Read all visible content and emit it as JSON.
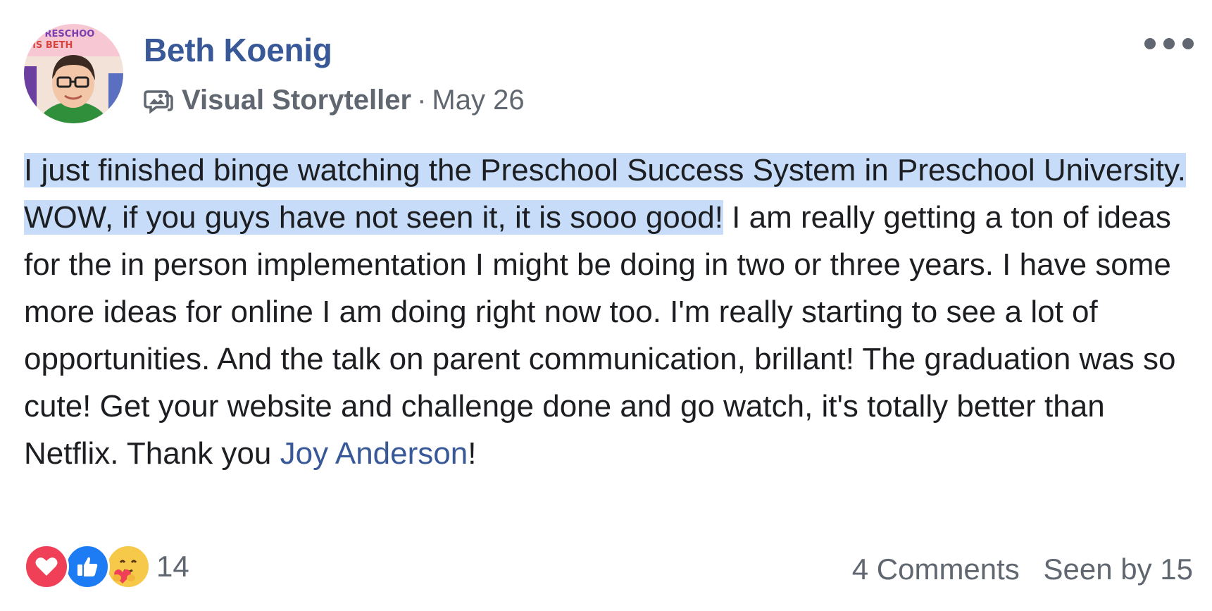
{
  "author": {
    "name": "Beth Koenig",
    "avatar_sign": "PRESCHOOL MS BETH"
  },
  "meta": {
    "badge": "Visual Storyteller",
    "separator": "·",
    "date": "May 26"
  },
  "post": {
    "highlighted_text": "I just finished binge watching the Preschool Success System in Preschool University. WOW, if you guys have not seen it, it is sooo good!",
    "text": " I am really getting a ton of ideas for the in person implementation I might be doing in two or three years. I have some more ideas for online I am doing right now too. I'm really starting to see a lot of opportunities. And the talk on parent communication, brillant! The graduation was so cute! Get your website and challenge done and go watch, it's totally better than Netflix. Thank you ",
    "mention": "Joy Anderson",
    "ending": "!"
  },
  "footer": {
    "reaction_icons": [
      "love-reaction-icon",
      "like-reaction-icon",
      "care-reaction-icon"
    ],
    "reaction_count": "14",
    "comments": "4 Comments",
    "seen_by": "Seen by 15"
  },
  "colors": {
    "link": "#385898",
    "secondary_text": "#606770",
    "highlight": "#c6dcf8",
    "love": "#ef4058",
    "like": "#1d7bf3",
    "care": "#f6c94a"
  }
}
